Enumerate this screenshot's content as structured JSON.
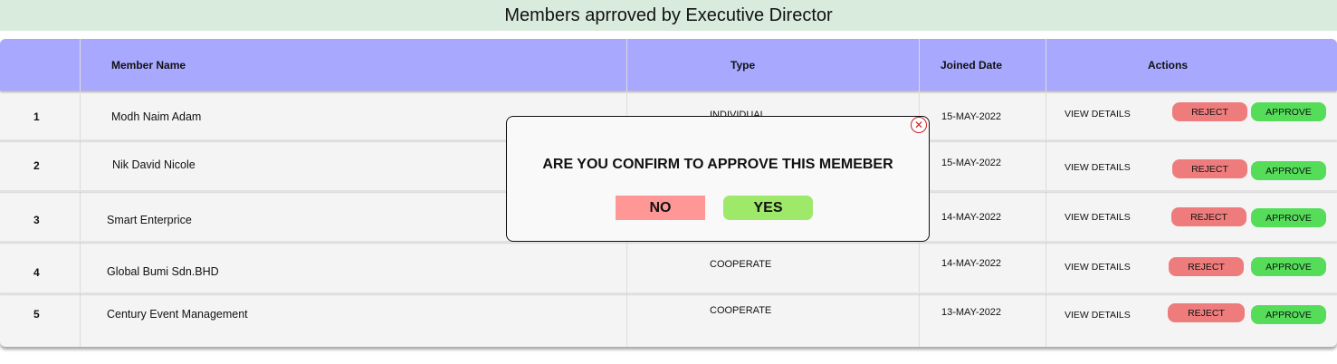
{
  "page": {
    "title": "Members aprroved  by Executive Director"
  },
  "table": {
    "headers": {
      "name": "Member Name",
      "type": "Type",
      "joined": "Joined Date",
      "actions": "Actions"
    },
    "rows": [
      {
        "no": "1",
        "name": "Modh Naim Adam",
        "type": "INDIVIDUAL",
        "joined": "15-MAY-2022",
        "view": "VIEW DETAILS",
        "reject": "REJECT",
        "approve": "APPROVE"
      },
      {
        "no": "2",
        "name": "Nik David Nicole",
        "type": "",
        "joined": "15-MAY-2022",
        "view": "VIEW DETAILS",
        "reject": "REJECT",
        "approve": "APPROVE"
      },
      {
        "no": "3",
        "name": "Smart Enterprice",
        "type": "",
        "joined": "14-MAY-2022",
        "view": "VIEW DETAILS",
        "reject": "REJECT",
        "approve": "APPROVE"
      },
      {
        "no": "4",
        "name": "Global Bumi Sdn.BHD",
        "type": "COOPERATE",
        "joined": "14-MAY-2022",
        "view": "VIEW DETAILS",
        "reject": "REJECT",
        "approve": "APPROVE"
      },
      {
        "no": "5",
        "name": "Century Event Management",
        "type": "COOPERATE",
        "joined": "13-MAY-2022",
        "view": "VIEW DETAILS",
        "reject": "REJECT",
        "approve": "APPROVE"
      }
    ]
  },
  "modal": {
    "message": "ARE YOU CONFIRM TO APPROVE THIS MEMEBER",
    "no_label": "NO",
    "yes_label": "YES",
    "close_glyph": "✕"
  },
  "icons": {
    "close": "close-icon"
  },
  "colors": {
    "title_bg": "#d9ebdc",
    "header_bg": "#a8a8ff",
    "reject": "#ee7c7c",
    "approve": "#55dd5a",
    "no": "#ff9797",
    "yes": "#9ee86a"
  }
}
